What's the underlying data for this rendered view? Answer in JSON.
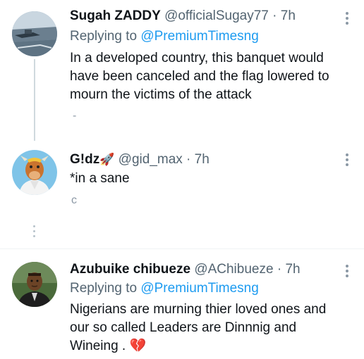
{
  "tweets": [
    {
      "name": "Sugah ZADDY",
      "handle": "@officialSugay77",
      "time": "7h",
      "replying_prefix": "Replying to",
      "replying_to": "@PremiumTimesng",
      "lines": [
        "In a developed country, this banquet would",
        "have been canceled and the flag lowered to",
        "mourn the victims of the attack"
      ],
      "avatar_icon": "avatar-photo-ship"
    },
    {
      "name": "G!dz",
      "name_emoji": "🚀",
      "handle": "@gid_max",
      "time": "7h",
      "text": "*in a sane",
      "avatar_icon": "avatar-cartoon-cow"
    },
    {
      "name": "Azubuike chibueze",
      "handle": "@AChibueze",
      "time": "7h",
      "replying_prefix": "Replying to",
      "replying_to": "@PremiumTimesng",
      "lines": [
        "Nigerians are murning thier loved ones and",
        "our so called Leaders are Dinnnig and",
        "Wineing . 💔"
      ],
      "avatar_icon": "avatar-photo-man"
    }
  ],
  "separator": " · ",
  "colors": {
    "text": "#0f1419",
    "secondary": "#536471",
    "link": "#1d9bf0",
    "broken_heart": "#e0245e"
  }
}
